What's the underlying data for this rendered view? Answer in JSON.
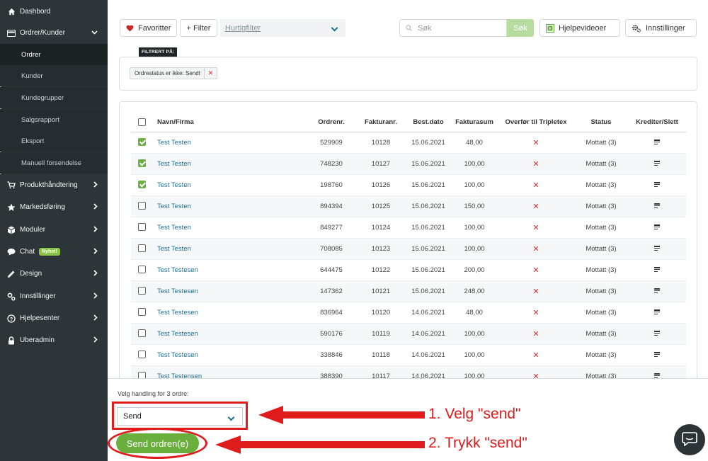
{
  "sidebar": {
    "items": [
      {
        "label": "Dashbord",
        "icon": "home-icon"
      },
      {
        "label": "Ordrer/Kunder",
        "icon": "card-icon"
      },
      {
        "label": "Produkthåndtering",
        "icon": "cart-icon"
      },
      {
        "label": "Markedsføring",
        "icon": "star-icon"
      },
      {
        "label": "Moduler",
        "icon": "cube-icon"
      },
      {
        "label": "Chat",
        "icon": "chat-icon",
        "badge": "Nyhet!"
      },
      {
        "label": "Design",
        "icon": "pencil-icon"
      },
      {
        "label": "Innstillinger",
        "icon": "settings-icon"
      },
      {
        "label": "Hjelpesenter",
        "icon": "help-icon"
      },
      {
        "label": "Uberadmin",
        "icon": "lock-icon"
      }
    ],
    "subitems": [
      "Ordrer",
      "Kunder",
      "Kundegrupper",
      "Salgsrapport",
      "Eksport",
      "Manuell forsendelse"
    ]
  },
  "toolbar": {
    "favorites_label": "Favoritter",
    "filter_label": "+ Filter",
    "quickfilter_label": "Hurtigfilter",
    "search_placeholder": "Søk",
    "search_button": "Søk",
    "help_videos_label": "Hjelpevideoer",
    "settings_label": "Innstillinger"
  },
  "filter": {
    "tag": "FILTRERT PÅ:",
    "chip": "Ordrestatus er ikke: Sendt"
  },
  "table": {
    "headers": [
      "Navn/Firma",
      "Ordrenr.",
      "Fakturanr.",
      "Best.dato",
      "Fakturasum",
      "Overfør til Tripletex",
      "Status",
      "Krediter/Slett"
    ],
    "rows": [
      {
        "checked": true,
        "name": "Test Testen",
        "order": "529909",
        "invoice": "10128",
        "date": "15.06.2021",
        "sum": "48,00",
        "status": "Mottatt (3)"
      },
      {
        "checked": true,
        "name": "Test Testen",
        "order": "748230",
        "invoice": "10127",
        "date": "15.06.2021",
        "sum": "100,00",
        "status": "Mottatt (3)"
      },
      {
        "checked": true,
        "name": "Test Testen",
        "order": "198760",
        "invoice": "10126",
        "date": "15.06.2021",
        "sum": "100,00",
        "status": "Mottatt (3)"
      },
      {
        "checked": false,
        "name": "Test Testen",
        "order": "894394",
        "invoice": "10125",
        "date": "15.06.2021",
        "sum": "150,00",
        "status": "Mottatt (3)"
      },
      {
        "checked": false,
        "name": "Test Testen",
        "order": "849277",
        "invoice": "10124",
        "date": "15.06.2021",
        "sum": "100,00",
        "status": "Mottatt (3)"
      },
      {
        "checked": false,
        "name": "Test Testen",
        "order": "708085",
        "invoice": "10123",
        "date": "15.06.2021",
        "sum": "100,00",
        "status": "Mottatt (3)"
      },
      {
        "checked": false,
        "name": "Test Testesen",
        "order": "644475",
        "invoice": "10122",
        "date": "15.06.2021",
        "sum": "200,00",
        "status": "Mottatt (3)"
      },
      {
        "checked": false,
        "name": "Test Testesen",
        "order": "147362",
        "invoice": "10121",
        "date": "15.06.2021",
        "sum": "248,00",
        "status": "Mottatt (3)"
      },
      {
        "checked": false,
        "name": "Test Testesen",
        "order": "836964",
        "invoice": "10120",
        "date": "14.06.2021",
        "sum": "48,00",
        "status": "Mottatt (3)"
      },
      {
        "checked": false,
        "name": "Test Testesen",
        "order": "590176",
        "invoice": "10119",
        "date": "14.06.2021",
        "sum": "100,00",
        "status": "Mottatt (3)"
      },
      {
        "checked": false,
        "name": "Test Testesen",
        "order": "338846",
        "invoice": "10118",
        "date": "14.06.2021",
        "sum": "100,00",
        "status": "Mottatt (3)"
      },
      {
        "checked": false,
        "name": "Test Testensen",
        "order": "388390",
        "invoice": "10117",
        "date": "14.06.2021",
        "sum": "100,00",
        "status": "Mottatt (3)"
      }
    ]
  },
  "action": {
    "label": "Velg handling for 3 ordre:",
    "selected": "Send",
    "send_button": "Send ordren(e)"
  },
  "annotations": {
    "step1": "1. Velg \"send\"",
    "step2": "2. Trykk \"send\""
  },
  "colors": {
    "sidebar_bg": "#2d3538",
    "accent_green": "#6aaf3d",
    "annotation_red": "#e01b1b",
    "link_blue": "#1b6f96"
  }
}
